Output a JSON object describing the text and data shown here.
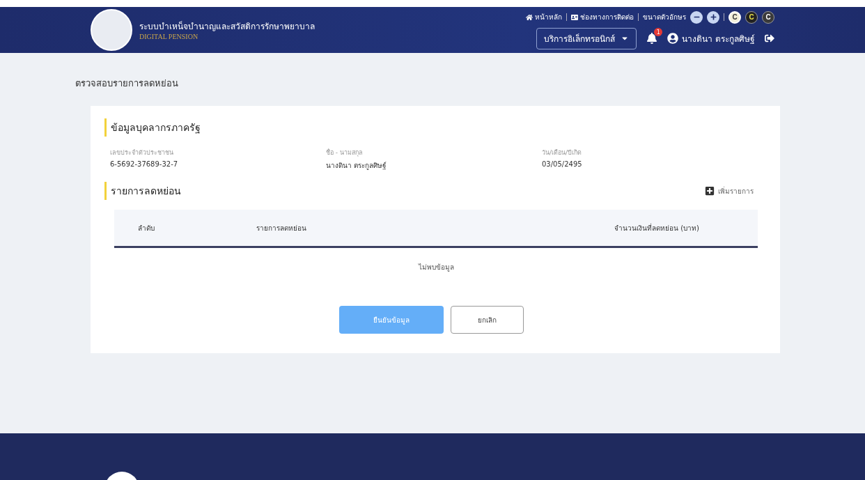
{
  "header": {
    "title": "ระบบบำเหน็จบำนาญและสวัสดิการรักษาพยาบาล",
    "subtitle": "DIGITAL PENSION",
    "top_links": [
      {
        "kind": "home",
        "label": "หน้าหลัก"
      },
      {
        "kind": "contact",
        "label": "ช่องทางการติดต่อ"
      }
    ],
    "font_size_label": "ขนาดตัวอักษร",
    "contrast_options": [
      {
        "label": "C",
        "selected": true
      },
      {
        "label": "C",
        "selected": false
      },
      {
        "label": "C",
        "selected": false
      }
    ],
    "service_menu": "บริการอิเล็กทรอนิกส์",
    "notification_count": "1",
    "user_name": "นางดินา ตระกูลศิษฐ์"
  },
  "page_title": "ตรวจสอบรายการลดหย่อน",
  "profile": {
    "heading": "ข้อมูลบุคลากรภาครัฐ",
    "fields": [
      {
        "label": "เลขประจำตัวประชาชน",
        "value": "6-5692-37689-32-7"
      },
      {
        "label": "ชื่อ - นามสกุล",
        "value": "นางดินา ตระกูลศิษฐ์"
      },
      {
        "label": "วัน/เดือน/ปีเกิด",
        "value": "03/05/2495"
      }
    ]
  },
  "deductions": {
    "heading": "รายการลดหย่อน",
    "add_label": "เพิ่มรายการ",
    "columns": [
      "ลำดับ",
      "รายการลดหย่อน",
      "จำนวนเงินที่ลดหย่อน (บาท)"
    ],
    "empty_text": "ไม่พบข้อมูล"
  },
  "buttons": [
    {
      "label": "ยืนยันข้อมูล",
      "kind": "primary",
      "disabled": true
    },
    {
      "label": "ยกเลิก",
      "kind": "secondary",
      "disabled": false
    }
  ]
}
